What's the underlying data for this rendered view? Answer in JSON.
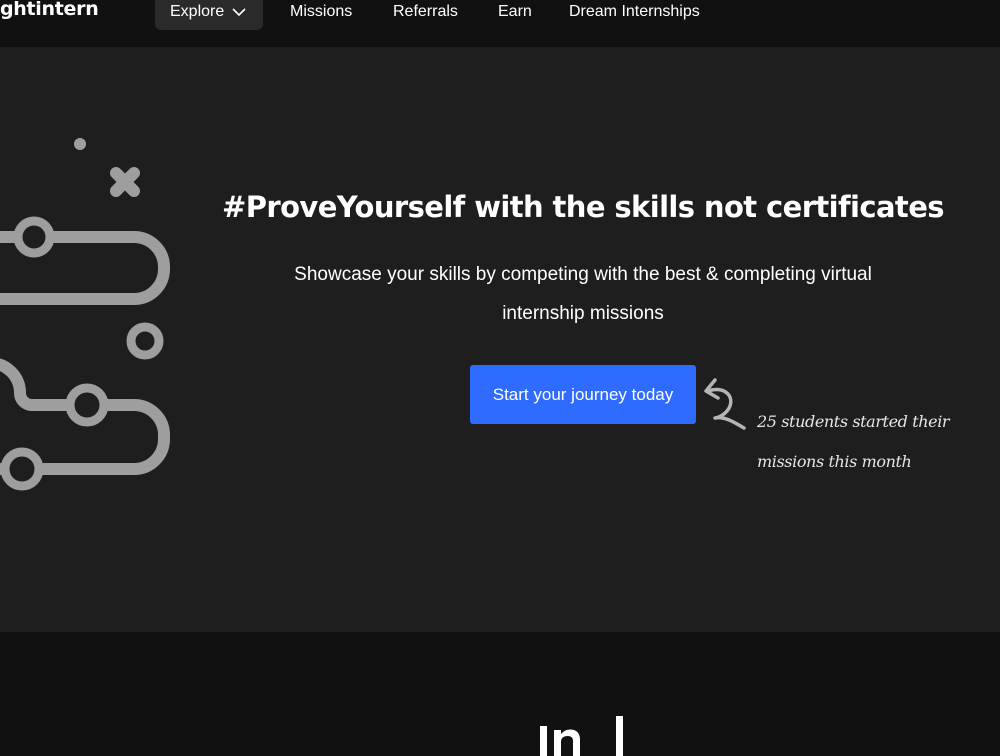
{
  "nav": {
    "brand": "ghtintern",
    "explore_label": "Explore",
    "links": [
      "Missions",
      "Referrals",
      "Earn",
      "Dream Internships"
    ]
  },
  "hero": {
    "title": "#ProveYourself with the skills not certificates",
    "subtitle": "Showcase your skills by competing with the best & completing virtual internship missions",
    "cta_label": "Start your journey today",
    "note": "25 students started their missions this month"
  },
  "colors": {
    "page_background": "#111111",
    "hero_background": "#1e1e1e",
    "explore_background": "#2a2a2a",
    "cta_background": "#2f6bff",
    "decoration": "#9e9e9e"
  },
  "icons": {
    "explore_caret": "chevron-down-icon",
    "note_arrow": "curved-arrow-icon"
  }
}
